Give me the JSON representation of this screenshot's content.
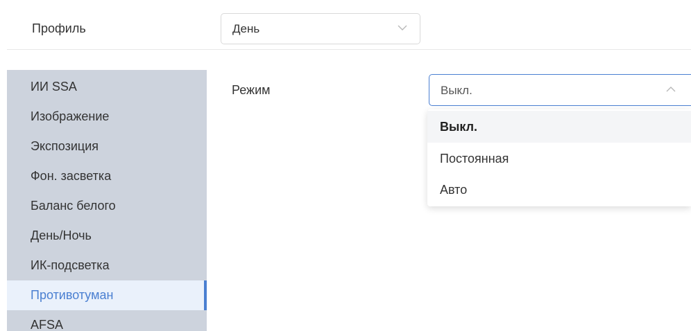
{
  "profile": {
    "label": "Профиль",
    "selected": "День"
  },
  "sidebar": {
    "items": [
      {
        "label": "ИИ SSA"
      },
      {
        "label": "Изображение"
      },
      {
        "label": "Экспозиция"
      },
      {
        "label": "Фон. засветка"
      },
      {
        "label": "Баланс белого"
      },
      {
        "label": "День/Ночь"
      },
      {
        "label": "ИК-подсветка"
      },
      {
        "label": "Противотуман"
      },
      {
        "label": "AFSA"
      }
    ],
    "active_index": 7
  },
  "mode": {
    "label": "Режим",
    "selected": "Выкл.",
    "options": [
      {
        "label": "Выкл."
      },
      {
        "label": "Постоянная"
      },
      {
        "label": "Авто"
      }
    ]
  },
  "colors": {
    "accent": "#4a7fd1",
    "sidebar_bg": "#cdd3dd",
    "active_bg": "#eaf1fb"
  },
  "icons": {
    "profile_select": "chevron-down-icon",
    "mode_select": "chevron-up-icon"
  }
}
